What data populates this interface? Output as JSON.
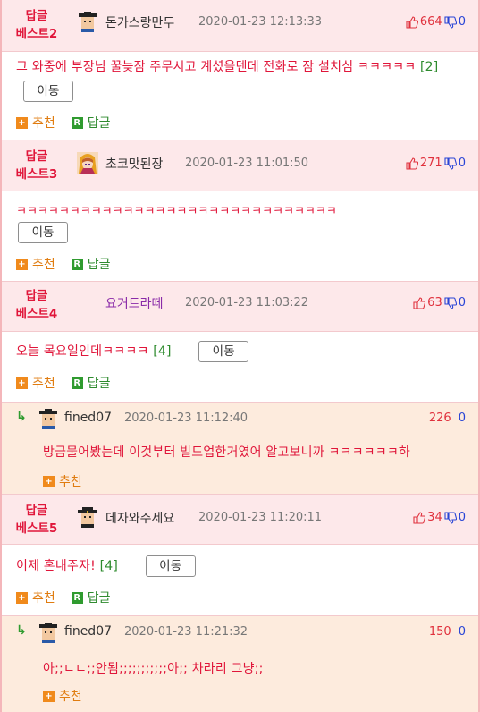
{
  "comments": [
    {
      "badge_line1": "답글",
      "badge_line2": "베스트2",
      "nick": "돈가스랑만두",
      "date": "2020-01-23 12:13:33",
      "up": "664",
      "down": "0",
      "text": "그 와중에 부장님 꿀늦잠 주무시고 계셨을텐데 전화로 잠 설치심 ㅋㅋㅋㅋㅋ",
      "count": "[2]",
      "move": "이동",
      "recommend": "추천",
      "reply": "답글"
    },
    {
      "badge_line1": "답글",
      "badge_line2": "베스트3",
      "nick": "초코맛된장",
      "date": "2020-01-23 11:01:50",
      "up": "271",
      "down": "0",
      "text": "ㅋㅋㅋㅋㅋㅋㅋㅋㅋㅋㅋㅋㅋㅋㅋㅋㅋㅋㅋㅋㅋㅋㅋㅋㅋㅋㅋㅋㅋㅋ",
      "move": "이동",
      "recommend": "추천",
      "reply": "답글"
    },
    {
      "badge_line1": "답글",
      "badge_line2": "베스트4",
      "nick": "요거트라떼",
      "date": "2020-01-23 11:03:22",
      "up": "63",
      "down": "0",
      "text": "오늘 목요일인데ㅋㅋㅋㅋ",
      "count": "[4]",
      "move": "이동",
      "recommend": "추천",
      "reply": "답글",
      "sub": {
        "nick": "fined07",
        "date": "2020-01-23 11:12:40",
        "up": "226",
        "down": "0",
        "text": "방금물어봤는데 이것부터 빌드업한거였어 알고보니까 ㅋㅋㅋㅋㅋㅋ하",
        "recommend": "추천"
      }
    },
    {
      "badge_line1": "답글",
      "badge_line2": "베스트5",
      "nick": "데자와주세요",
      "date": "2020-01-23 11:20:11",
      "up": "34",
      "down": "0",
      "text": "이제 혼내주자!",
      "count": "[4]",
      "move": "이동",
      "recommend": "추천",
      "reply": "답글",
      "sub": {
        "nick": "fined07",
        "date": "2020-01-23 11:21:32",
        "up": "150",
        "down": "0",
        "text": "아;;ㄴㄴ;;안됨;;;;;;;;;;;아;; 차라리 그냥;;",
        "recommend": "추천"
      }
    }
  ],
  "icons": {
    "thumb_up": "thumbs-up-icon",
    "thumb_down": "thumbs-down-icon",
    "recommend": "plus-square-icon",
    "reply": "reply-r-icon",
    "reply_arrow": "reply-arrow-icon"
  },
  "colors": {
    "header_bg": "#fde8ea",
    "accent_red": "#e0163a",
    "reply_bg": "#fdebdd",
    "border_pink": "#f4b6ba"
  }
}
